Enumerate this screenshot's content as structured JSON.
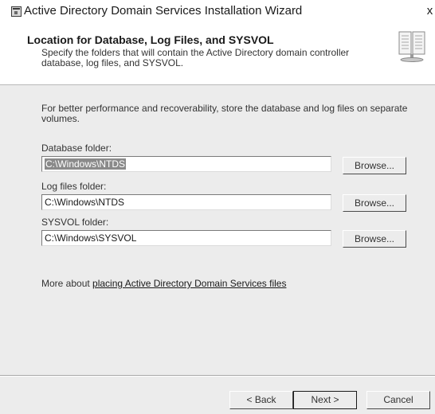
{
  "window": {
    "title": "Active Directory Domain Services Installation Wizard",
    "close_glyph": "x"
  },
  "header": {
    "title": "Location for Database, Log Files, and SYSVOL",
    "description": "Specify the folders that will contain the Active Directory domain controller database, log files, and SYSVOL.",
    "icon": "book-icon"
  },
  "body": {
    "intro": "For better performance and recoverability, store the database and log files on separate volumes.",
    "fields": [
      {
        "label": "Database folder:",
        "value": "C:\\Windows\\NTDS",
        "browse_label": "Browse..."
      },
      {
        "label": "Log files folder:",
        "value": "C:\\Windows\\NTDS",
        "browse_label": "Browse..."
      },
      {
        "label": "SYSVOL folder:",
        "value": "C:\\Windows\\SYSVOL",
        "browse_label": "Browse..."
      }
    ],
    "more_prefix": "More about ",
    "more_link": "placing Active Directory Domain Services files"
  },
  "footer": {
    "back_label": "< Back",
    "next_label": "Next >",
    "cancel_label": "Cancel"
  }
}
